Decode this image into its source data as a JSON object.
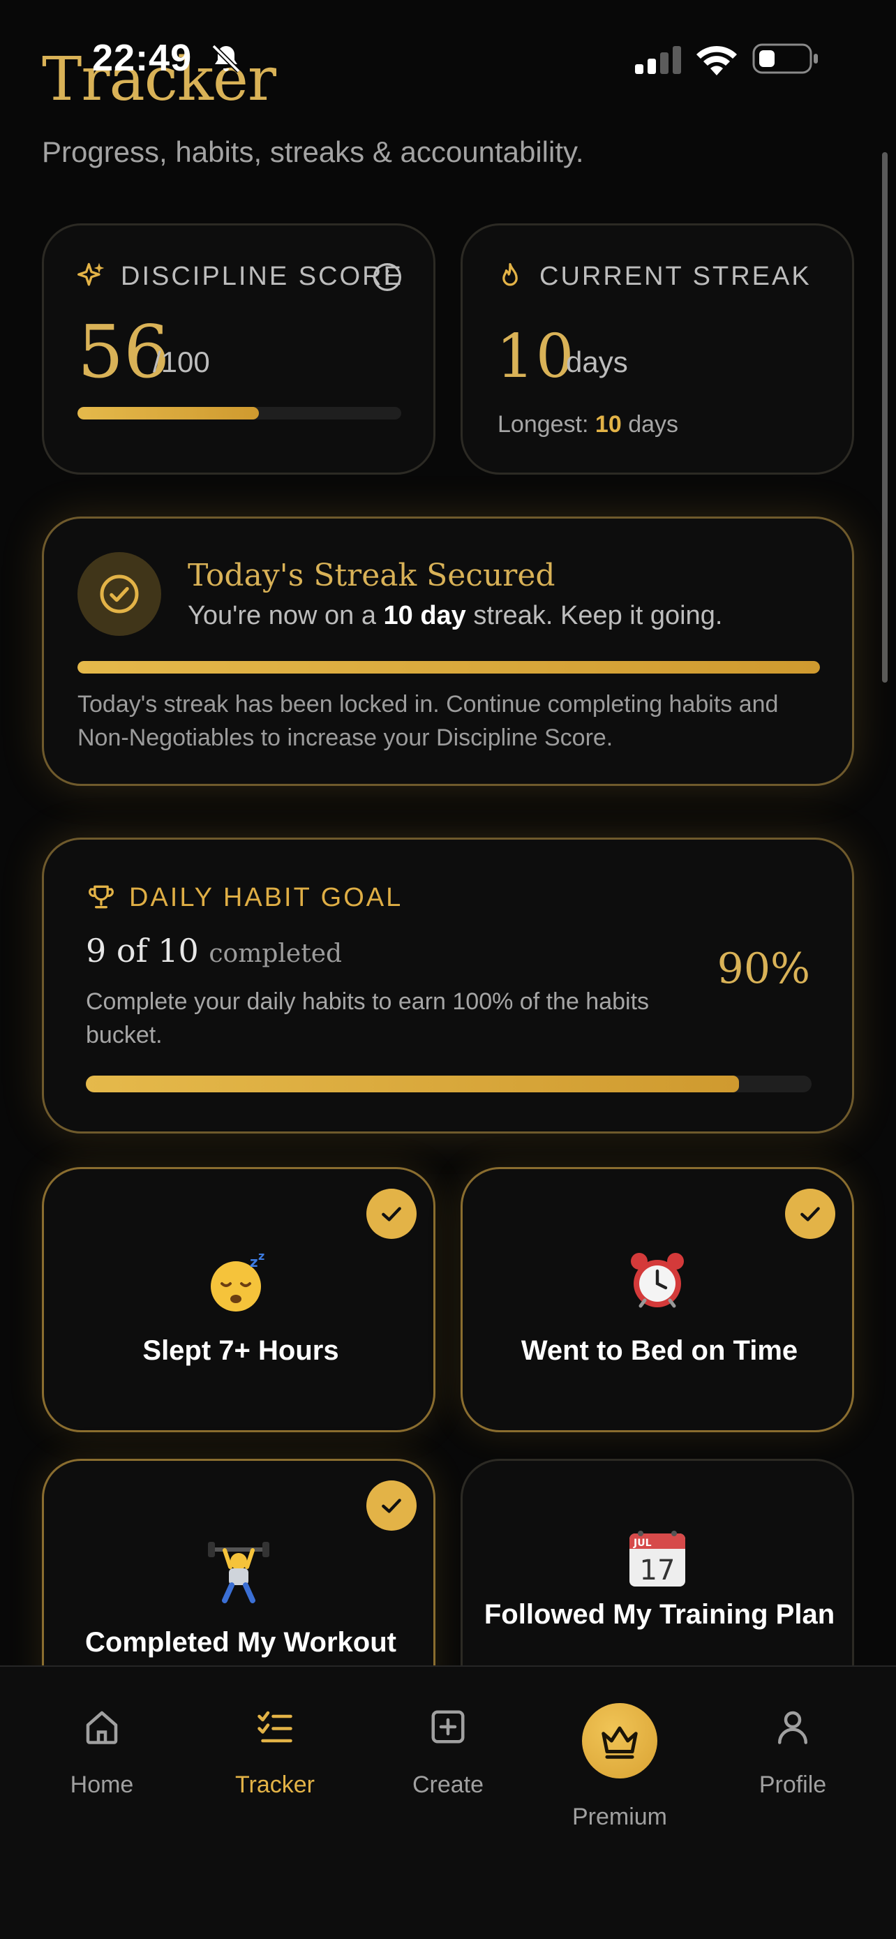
{
  "status_bar": {
    "time": "22:49"
  },
  "header": {
    "title": "Tracker",
    "subtitle": "Progress, habits, streaks & accountability."
  },
  "discipline": {
    "label": "DISCIPLINE SCORE",
    "score": "56",
    "max": "/100",
    "progress": 0.56
  },
  "streak": {
    "label": "CURRENT STREAK",
    "value": "10",
    "unit": "days",
    "longest_prefix": "Longest:",
    "longest_value": "10",
    "longest_unit": "days"
  },
  "secured": {
    "title": "Today's Streak Secured",
    "text_before": "You're now on a",
    "text_bold": "10 day",
    "text_after": "streak. Keep it going.",
    "progress": 1.0,
    "note": "Today's streak has been locked in. Continue completing habits and Non-Negotiables to increase your Discipline Score."
  },
  "goal": {
    "label": "DAILY HABIT GOAL",
    "count": "9 of 10",
    "count_suffix": "completed",
    "description": "Complete your daily habits to earn 100% of the habits bucket.",
    "percent": "90%",
    "progress": 0.9
  },
  "habits": [
    {
      "label": "Slept 7+ Hours",
      "emoji": "sleeping-face-icon",
      "done": true
    },
    {
      "label": "Went to Bed on Time",
      "emoji": "alarm-clock-icon",
      "done": true
    },
    {
      "label": "Completed My Workout",
      "emoji": "weight-lifter-icon",
      "done": true
    },
    {
      "label": "Followed My Training Plan",
      "emoji": "calendar-icon",
      "done": false,
      "calendar_month": "JUL",
      "calendar_day": "17"
    }
  ],
  "tabs": [
    {
      "label": "Home",
      "icon": "home-icon",
      "active": false
    },
    {
      "label": "Tracker",
      "icon": "checklist-icon",
      "active": true
    },
    {
      "label": "Create",
      "icon": "plus-square-icon",
      "active": false
    },
    {
      "label": "Premium",
      "icon": "crown-icon",
      "active": false
    },
    {
      "label": "Profile",
      "icon": "person-icon",
      "active": false
    }
  ],
  "colors": {
    "gold": "#d9b257",
    "background": "#080808",
    "card": "#0d0d0d"
  }
}
